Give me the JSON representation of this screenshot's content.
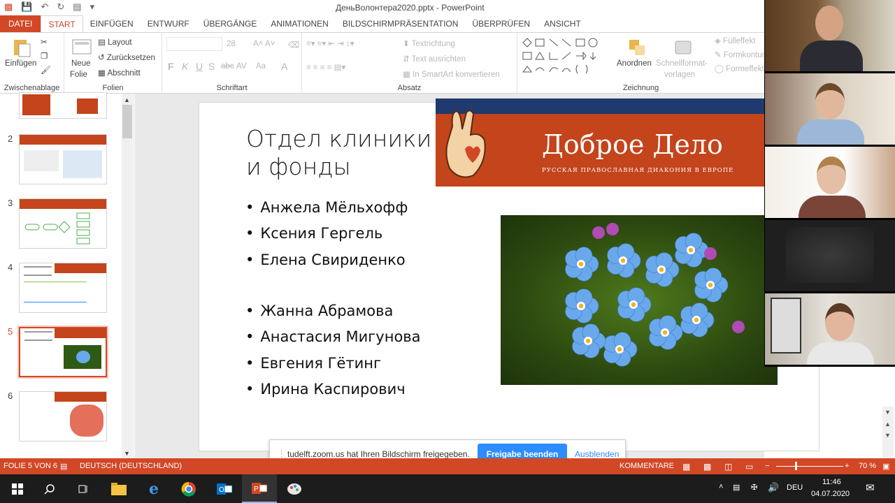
{
  "window": {
    "title": "ДеньВолонтера2020.pptx - PowerPoint"
  },
  "tabs": [
    {
      "label": "DATEI"
    },
    {
      "label": "START"
    },
    {
      "label": "EINFÜGEN"
    },
    {
      "label": "ENTWURF"
    },
    {
      "label": "ÜBERGÄNGE"
    },
    {
      "label": "ANIMATIONEN"
    },
    {
      "label": "BILDSCHIRMPRÄSENTATION"
    },
    {
      "label": "ÜBERPRÜFEN"
    },
    {
      "label": "ANSICHT"
    }
  ],
  "ribbon": {
    "clipboard": {
      "paste": "Einfügen",
      "group": "Zwischenablage"
    },
    "slides": {
      "new_slide": "Neue",
      "new_slide2": "Folie",
      "layout": "Layout",
      "reset": "Zurücksetzen",
      "section": "Abschnitt",
      "group": "Folien"
    },
    "font": {
      "size": "28",
      "bold": "F",
      "italic": "K",
      "underline": "U",
      "shadow": "S",
      "strike": "abc",
      "spacing": "AV",
      "case": "Aa",
      "color": "A",
      "group": "Schriftart"
    },
    "paragraph": {
      "text_direction": "Textrichtung",
      "align_text": "Text ausrichten",
      "smartart": "In SmartArt konvertieren",
      "group": "Absatz"
    },
    "drawing": {
      "arrange": "Anordnen",
      "quick_styles": "Schnellformat-",
      "quick_styles2": "vorlagen",
      "fill": "Fülleffekt",
      "outline": "Formkontur",
      "effects": "Formeffekt",
      "group": "Zeichnung"
    }
  },
  "thumbnails": [
    {
      "num": ""
    },
    {
      "num": "2"
    },
    {
      "num": "3"
    },
    {
      "num": "4"
    },
    {
      "num": "5"
    },
    {
      "num": "6"
    }
  ],
  "slide": {
    "title": "Отдел клиники и фонды",
    "list1": [
      "Анжела Мёльхофф",
      "Ксения Гергель",
      "Елена Свириденко"
    ],
    "list2": [
      "Жанна Абрамова",
      "Анастасия Мигунова",
      "Евгения Гётинг",
      "Ирина Каспирович"
    ],
    "banner_title": "Доброе Дело",
    "banner_subtitle": "РУССКАЯ ПРАВОСЛАВНАЯ ДИАКОНИЯ В ЕВРОПЕ"
  },
  "sharebar": {
    "message": "tudelft.zoom.us hat Ihren Bildschirm freigegeben.",
    "stop": "Freigabe beenden",
    "hide": "Ausblenden"
  },
  "status": {
    "slide_of": "FOLIE 5 VON 6",
    "language": "DEUTSCH (DEUTSCHLAND)",
    "comments": "KOMMENTARE",
    "zoom": "70 %"
  },
  "taskbar": {
    "lang": "DEU",
    "time": "11:46",
    "date": "04.07.2020"
  },
  "colors": {
    "accent": "#d24726",
    "zoom_blue": "#2d8cff",
    "banner": "#c4441c"
  }
}
